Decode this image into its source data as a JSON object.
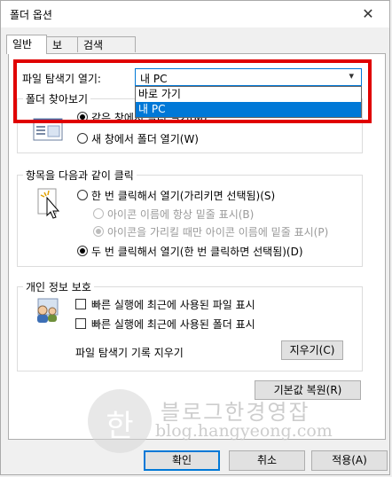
{
  "window": {
    "title": "폴더 옵션",
    "close_glyph": "✕"
  },
  "tabs": [
    {
      "label": "일반",
      "active": true
    },
    {
      "label": "보기",
      "active": false
    },
    {
      "label": "검색",
      "active": false
    }
  ],
  "explorer_open": {
    "label": "파일 탐색기 열기:",
    "value": "내 PC",
    "options": [
      "바로 가기",
      "내 PC"
    ],
    "selected_option": "내 PC"
  },
  "browse_folders": {
    "legend": "폴더 찾아보기",
    "same_window": "같은 창에서 폴더 열기(M)",
    "new_window": "새 창에서 폴더 열기(W)",
    "selected": "same_window"
  },
  "click_items": {
    "legend": "항목을 다음과 같이 클릭",
    "single_click": "한 번 클릭해서 열기(가리키면 선택됨)(S)",
    "underline_always": "아이콘 이름에 항상 밑줄 표시(B)",
    "underline_hover": "아이콘을 가리킬 때만 아이콘 이름에 밑줄 표시(P)",
    "double_click": "두 번 클릭해서 열기(한 번 클릭하면 선택됨)(D)",
    "selected": "double_click"
  },
  "privacy": {
    "legend": "개인 정보 보호",
    "recent_files": "빠른 실행에 최근에 사용된 파일 표시",
    "recent_folders": "빠른 실행에 최근에 사용된 폴더 표시",
    "clear_label": "파일 탐색기 기록 지우기",
    "clear_button": "지우기(C)"
  },
  "restore_defaults": "기본값 복원(R)",
  "footer": {
    "ok": "확인",
    "cancel": "취소",
    "apply": "적용(A)"
  },
  "watermark": {
    "glyph": "한",
    "name": "블로그한경영잡",
    "url": "blog.hangyeong.com"
  },
  "colors": {
    "accent": "#0078d7",
    "highlight": "#e00000"
  }
}
